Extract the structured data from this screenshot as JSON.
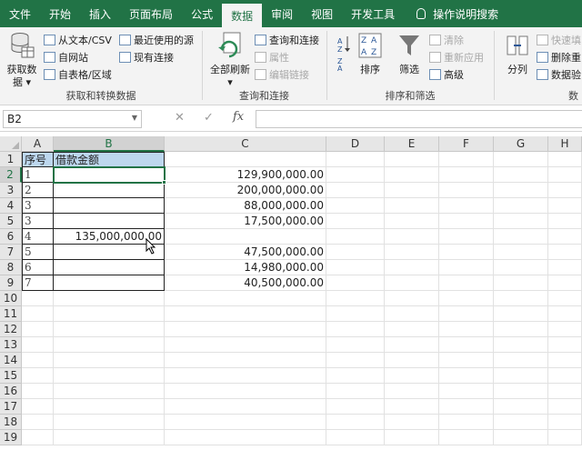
{
  "tabs": [
    {
      "label": "文件",
      "active": false
    },
    {
      "label": "开始",
      "active": false
    },
    {
      "label": "插入",
      "active": false
    },
    {
      "label": "页面布局",
      "active": false
    },
    {
      "label": "公式",
      "active": false
    },
    {
      "label": "数据",
      "active": true
    },
    {
      "label": "审阅",
      "active": false
    },
    {
      "label": "视图",
      "active": false
    },
    {
      "label": "开发工具",
      "active": false
    }
  ],
  "tell_me": "操作说明搜索",
  "ribbon": {
    "get_data": {
      "big_label_1": "获取数",
      "big_label_2": "据 ▾",
      "from_text_csv": "从文本/CSV",
      "from_web": "自网站",
      "from_table": "自表格/区域",
      "recent_sources": "最近使用的源",
      "existing_connections": "现有连接",
      "group_label": "获取和转换数据"
    },
    "queries": {
      "refresh_all_1": "全部刷新",
      "refresh_all_2": "▾",
      "queries_connections": "查询和连接",
      "properties": "属性",
      "edit_links": "编辑链接",
      "group_label": "查询和连接"
    },
    "sort_filter": {
      "sort": "排序",
      "filter": "筛选",
      "clear": "清除",
      "reapply": "重新应用",
      "advanced": "高级",
      "group_label": "排序和筛选"
    },
    "data_tools": {
      "text_to_columns": "分列",
      "flash_fill": "快速填",
      "remove_duplicates": "删除重",
      "data_validation": "数据验",
      "group_label": "数"
    }
  },
  "formula_bar": {
    "name_box": "B2",
    "cancel": "✕",
    "enter": "✓",
    "fx": "fx",
    "formula": ""
  },
  "columns": [
    "A",
    "B",
    "C",
    "D",
    "E",
    "F",
    "G",
    "H"
  ],
  "rows": [
    "1",
    "2",
    "3",
    "4",
    "5",
    "6",
    "7",
    "8",
    "9",
    "10",
    "11",
    "12",
    "13",
    "14",
    "15",
    "16",
    "17",
    "18",
    "19"
  ],
  "sheet": {
    "A1": "序号",
    "B1": "借款金额",
    "A2": "1",
    "A3": "2",
    "A4": "3",
    "A5": "3",
    "A6": "4",
    "A7": "5",
    "A8": "6",
    "A9": "7",
    "B6": "135,000,000.00",
    "C2": "129,900,000.00",
    "C3": "200,000,000.00",
    "C4": "88,000,000.00",
    "C5": "17,500,000.00",
    "C7": "47,500,000.00",
    "C8": "14,980,000.00",
    "C9": "40,500,000.00"
  },
  "colors": {
    "excel_green": "#217346",
    "header_fill": "#bdd7ee"
  }
}
